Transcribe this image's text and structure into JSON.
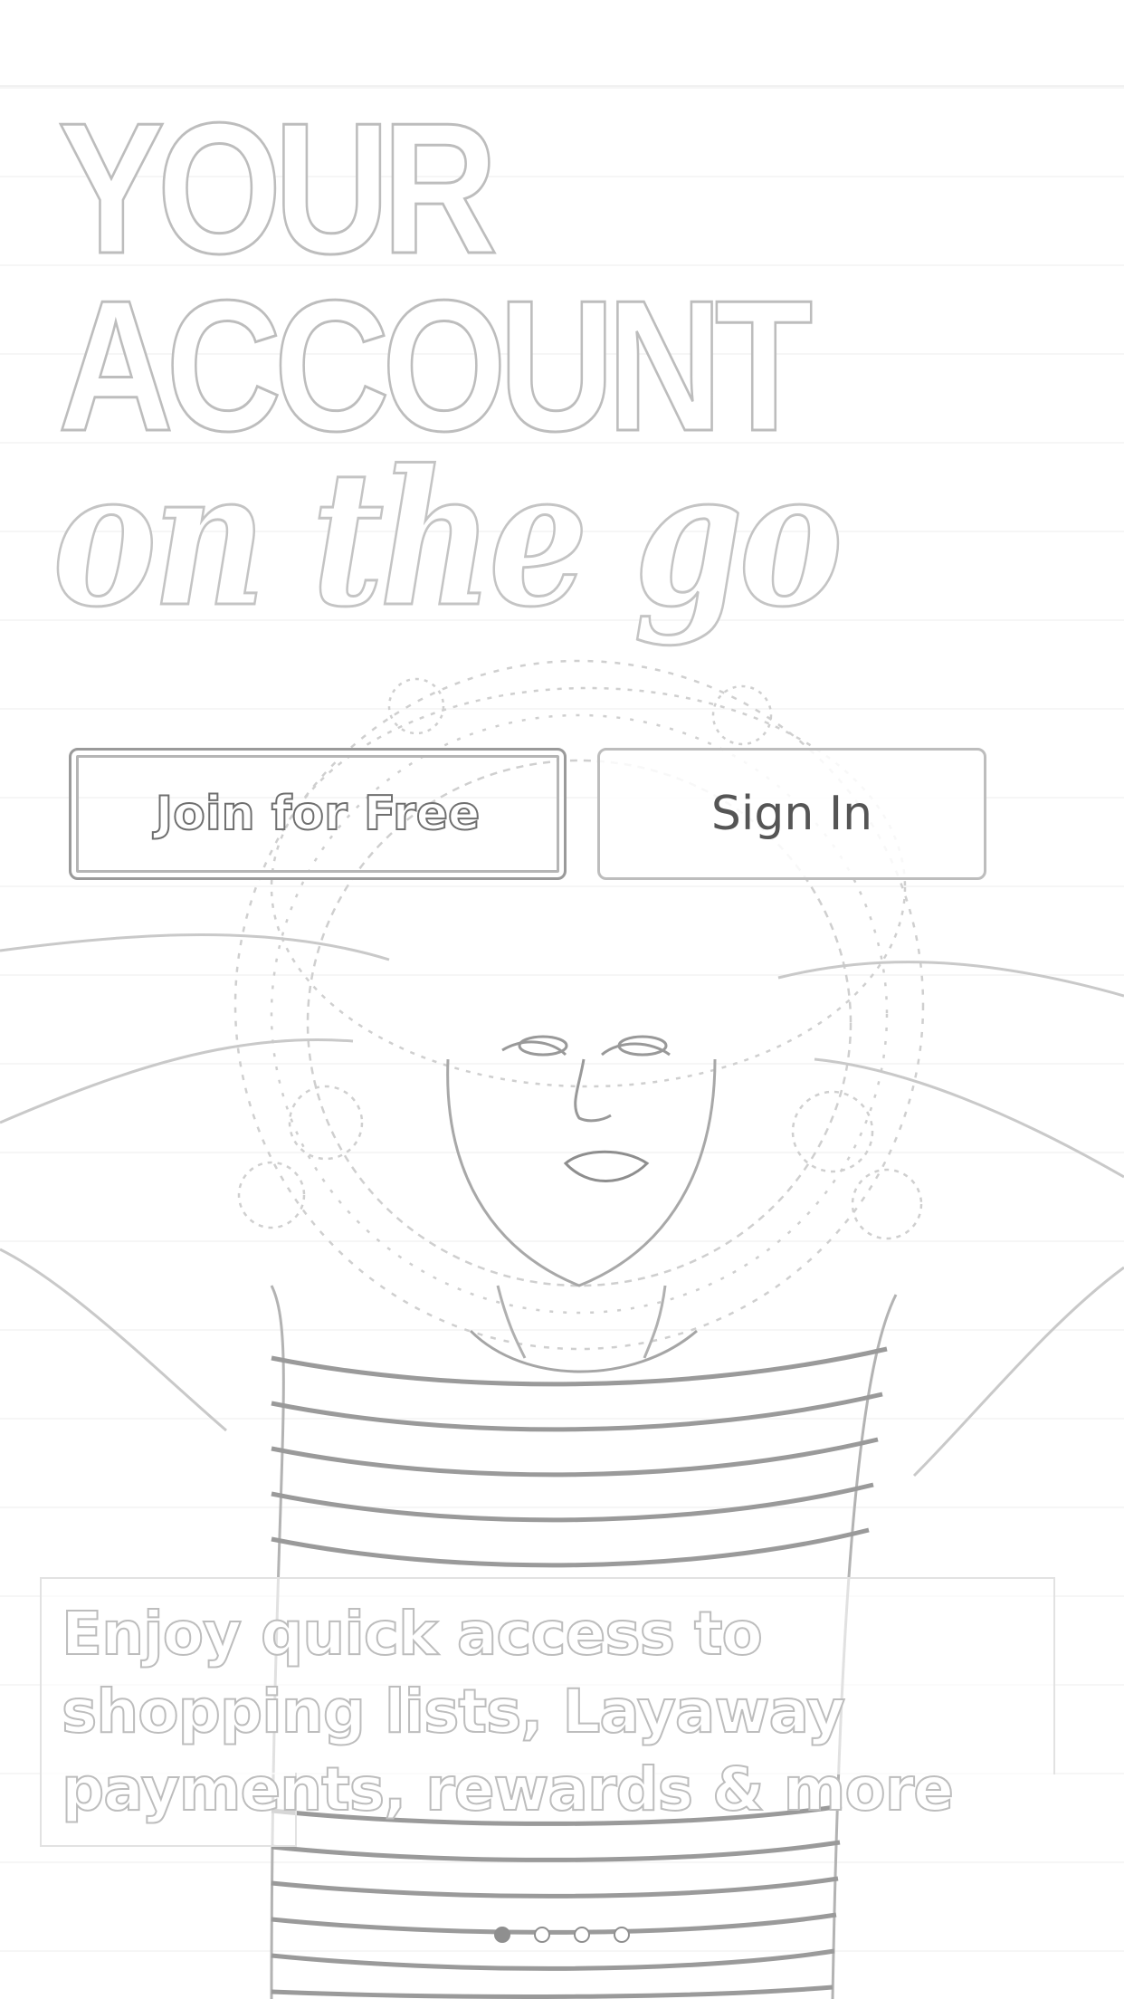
{
  "hero": {
    "headline_lines": [
      "YOUR",
      "ACCOUNT"
    ],
    "tagline": "on the go",
    "photo": "woman-with-curly-hair-in-striped-tee-icon"
  },
  "actions": {
    "join_label": "Join for Free",
    "signin_label": "Sign In"
  },
  "promo": {
    "text": "Enjoy quick access to shopping lists, Layaway payments, rewards & more"
  },
  "carousel": {
    "page_count": 4,
    "active_index": 0
  },
  "colors": {
    "outline": "#bdbdbd",
    "button_text": "#555555",
    "background": "#ffffff"
  }
}
